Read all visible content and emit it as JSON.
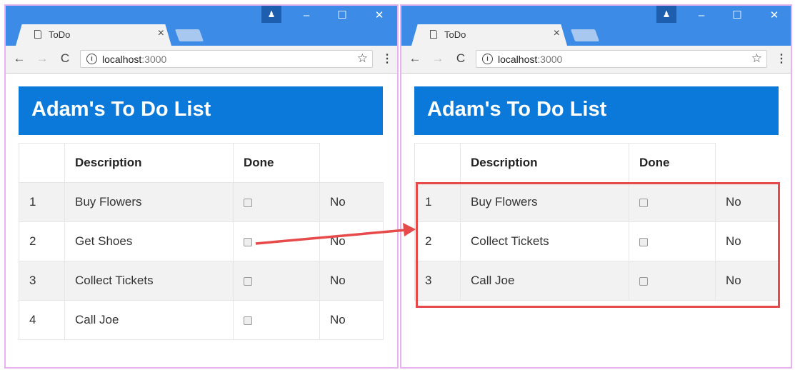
{
  "windows": [
    {
      "tab_title": "ToDo",
      "url_host": "localhost",
      "url_port": ":3000",
      "page_title": "Adam's To Do List",
      "columns": [
        "Description",
        "Done"
      ],
      "rows": [
        {
          "num": "1",
          "description": "Buy Flowers",
          "status": "No"
        },
        {
          "num": "2",
          "description": "Get Shoes",
          "status": "No"
        },
        {
          "num": "3",
          "description": "Collect Tickets",
          "status": "No"
        },
        {
          "num": "4",
          "description": "Call Joe",
          "status": "No"
        }
      ]
    },
    {
      "tab_title": "ToDo",
      "url_host": "localhost",
      "url_port": ":3000",
      "page_title": "Adam's To Do List",
      "columns": [
        "Description",
        "Done"
      ],
      "rows": [
        {
          "num": "1",
          "description": "Buy Flowers",
          "status": "No"
        },
        {
          "num": "2",
          "description": "Collect Tickets",
          "status": "No"
        },
        {
          "num": "3",
          "description": "Call Joe",
          "status": "No"
        }
      ]
    }
  ],
  "colors": {
    "titlebar": "#3c8ce7",
    "header": "#0b79da",
    "highlight": "#e64a4a",
    "frame": "#e6b3ef"
  },
  "icons": {
    "tab": "document-icon",
    "close": "close-icon",
    "back": "back-arrow-icon",
    "forward": "forward-arrow-icon",
    "reload": "reload-icon",
    "info": "info-icon",
    "bookmark": "star-icon",
    "menu": "menu-dots-icon",
    "profile": "profile-icon",
    "minimize": "minimize-icon",
    "maximize": "maximize-icon"
  }
}
